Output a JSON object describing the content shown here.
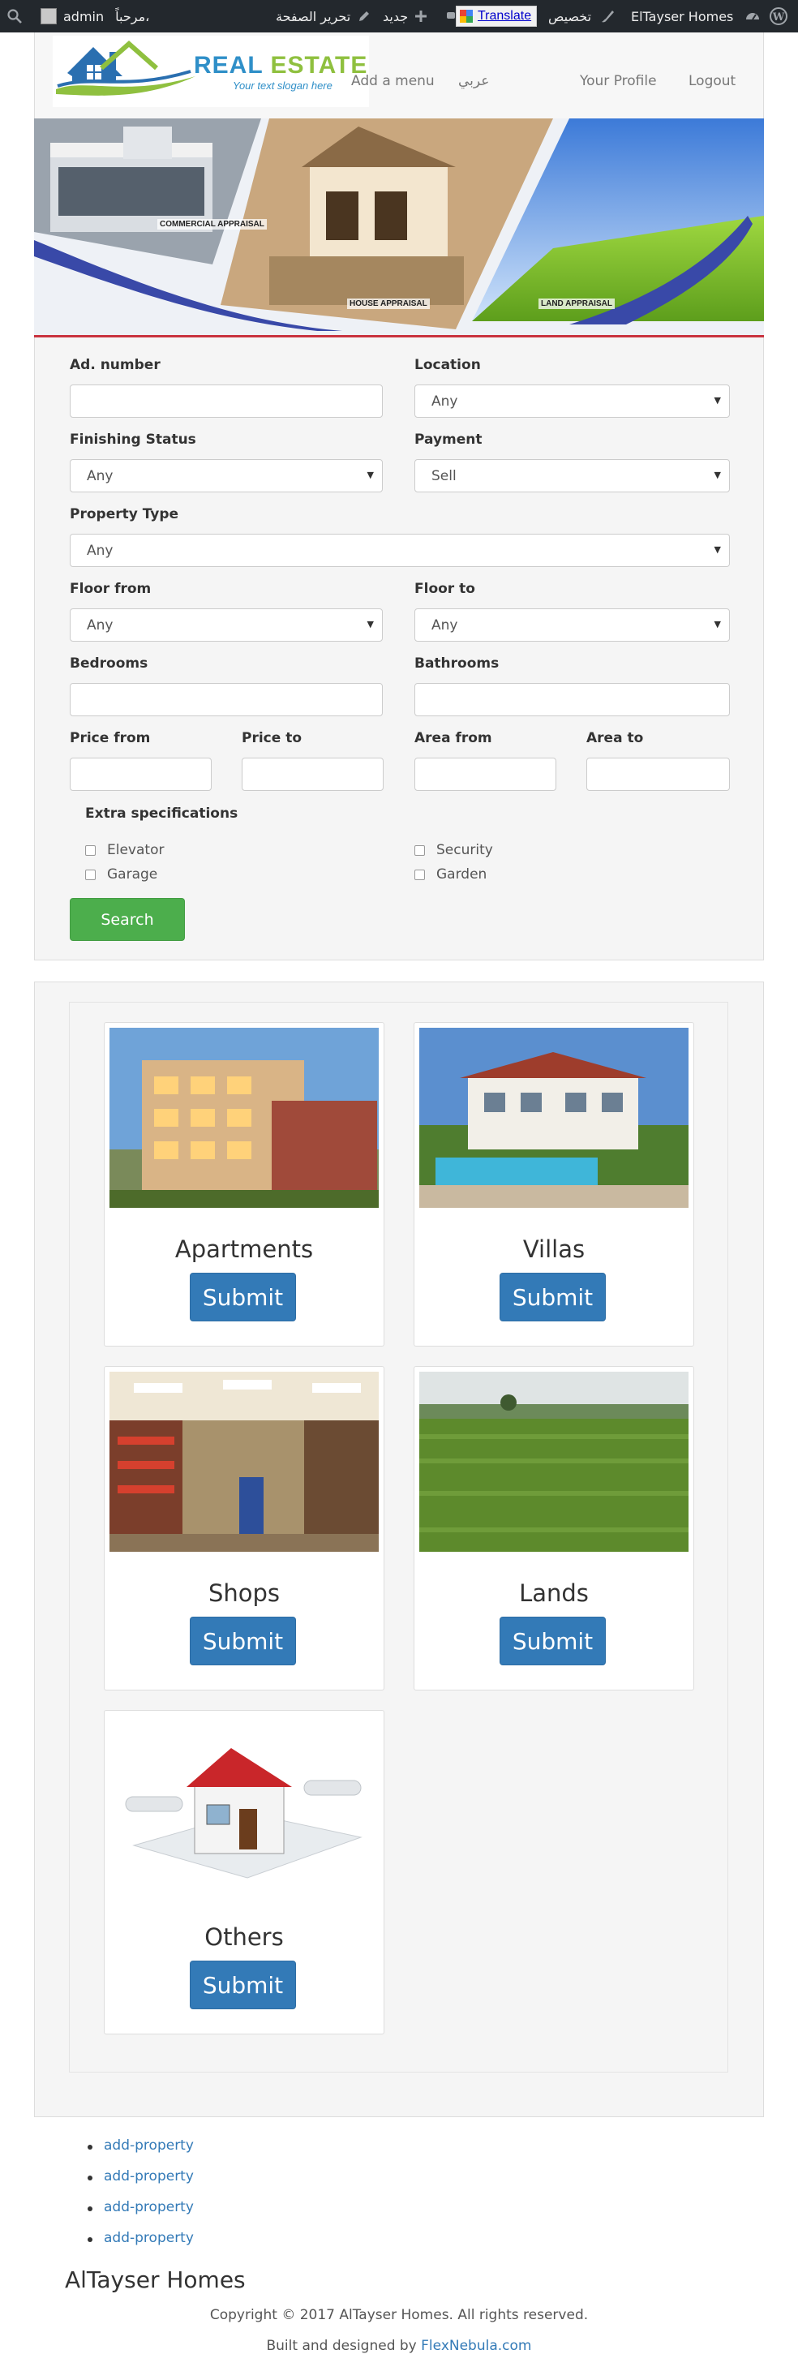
{
  "adminbar": {
    "site_name": "ElTayser Homes",
    "customize": "تخصيص",
    "translate": "Translate",
    "edit_page": "تحرير الصفحة",
    "new": "جديد",
    "user_name": "admin",
    "greeting": "مرحباً،"
  },
  "header": {
    "logo_title": "REAL ESTATE",
    "logo_title_a": "REAL ",
    "logo_title_b": "ESTATE",
    "logo_slogan": "Your text slogan here",
    "nav": {
      "add_menu": "Add a menu",
      "arabic": "عربي",
      "profile": "Your Profile",
      "logout": "Logout"
    }
  },
  "banner": {
    "labels": [
      "COMMERCIAL APPRAISAL",
      "HOUSE APPRAISAL",
      "LAND APPRAISAL"
    ]
  },
  "search": {
    "ad_number_label": "Ad. number",
    "location_label": "Location",
    "location_value": "Any",
    "finishing_label": "Finishing Status",
    "finishing_value": "Any",
    "payment_label": "Payment",
    "payment_value": "Sell",
    "property_type_label": "Property Type",
    "property_type_value": "Any",
    "floor_from_label": "Floor from",
    "floor_from_value": "Any",
    "floor_to_label": "Floor to",
    "floor_to_value": "Any",
    "bedrooms_label": "Bedrooms",
    "bathrooms_label": "Bathrooms",
    "price_from_label": "Price from",
    "price_to_label": "Price to",
    "area_from_label": "Area from",
    "area_to_label": "Area to",
    "extra_title": "Extra specifications",
    "extras": [
      "Elevator",
      "Security",
      "Garage",
      "Garden"
    ],
    "search_button": "Search"
  },
  "categories": [
    {
      "title": "Apartments",
      "button": "Submit"
    },
    {
      "title": "Villas",
      "button": "Submit"
    },
    {
      "title": "Shops",
      "button": "Submit"
    },
    {
      "title": "Lands",
      "button": "Submit"
    },
    {
      "title": "Others",
      "button": "Submit"
    }
  ],
  "footer": {
    "links": [
      "add-property",
      "add-property",
      "add-property",
      "add-property"
    ],
    "site_name": "AlTayser Homes",
    "copyright": "Copyright © 2017 AlTayser Homes. All rights reserved.",
    "built_prefix": "Built and designed by ",
    "built_link": "FlexNebula.com"
  }
}
